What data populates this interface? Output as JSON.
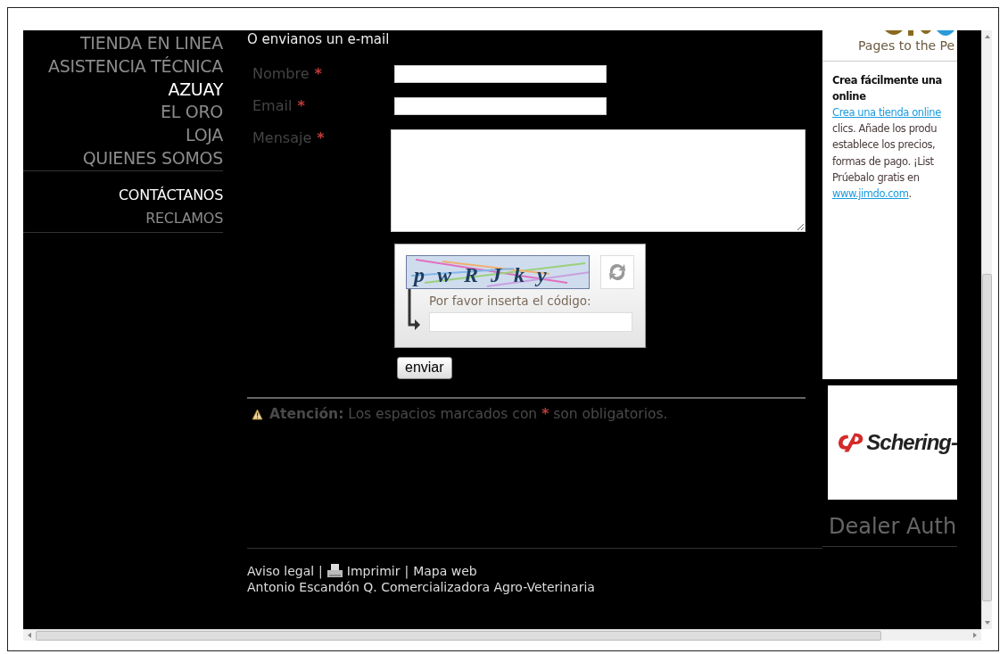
{
  "sidebar": {
    "groups": [
      [
        {
          "label": "TIENDA EN LINEA",
          "selected": false
        },
        {
          "label": "ASISTENCIA TÉCNICA",
          "selected": false
        },
        {
          "label": "AZUAY",
          "selected": true
        },
        {
          "label": "EL ORO",
          "selected": false
        },
        {
          "label": "LOJA",
          "selected": false
        },
        {
          "label": "QUIENES SOMOS",
          "selected": false
        }
      ],
      [
        {
          "label": "CONTÁCTANOS",
          "selected": true
        },
        {
          "label": "RECLAMOS",
          "selected": false
        }
      ]
    ]
  },
  "form": {
    "title": "O envianos un e-mail",
    "required_mark": "*",
    "fields": [
      {
        "label": "Nombre",
        "required": true,
        "kind": "input"
      },
      {
        "label": "Email",
        "required": true,
        "kind": "input"
      },
      {
        "label": "Mensaje",
        "required": true,
        "kind": "textarea"
      }
    ],
    "captcha": {
      "code": "pwRJky",
      "prompt": "Por favor inserta el código:"
    },
    "submit": "enviar",
    "note": {
      "label": "Atención:",
      "before": "Los espacios marcados con",
      "mark": "*",
      "after": "son obligatorios."
    }
  },
  "footer": {
    "links": [
      {
        "text": "Aviso legal",
        "kind": "link"
      },
      {
        "text": "|",
        "kind": "sep"
      },
      {
        "text": "Imprimir",
        "kind": "print"
      },
      {
        "text": "|",
        "kind": "sep"
      },
      {
        "text": "Mapa web",
        "kind": "link"
      }
    ],
    "company": "Antonio Escandón Q. Comercializadora Agro-Veterinaria"
  },
  "ad": {
    "tagline": "Pages to the Pe",
    "heading": [
      "Crea fácilmente una",
      "online"
    ],
    "lines": [
      [
        {
          "text": "Crea una tienda online",
          "link": true
        }
      ],
      [
        {
          "text": "clics. Añade los produ",
          "link": false
        }
      ],
      [
        {
          "text": "establece los precios,",
          "link": false
        }
      ],
      [
        {
          "text": "formas de pago. ¡List",
          "link": false
        }
      ],
      [
        {
          "text": "Prúebalo gratis en",
          "link": false
        }
      ],
      [
        {
          "text": "www.jimdo.com",
          "link": true
        },
        {
          "text": ".",
          "link": false
        }
      ]
    ]
  },
  "sponsor": {
    "name": "Schering-"
  },
  "dealer": {
    "title": "Dealer Auth"
  }
}
